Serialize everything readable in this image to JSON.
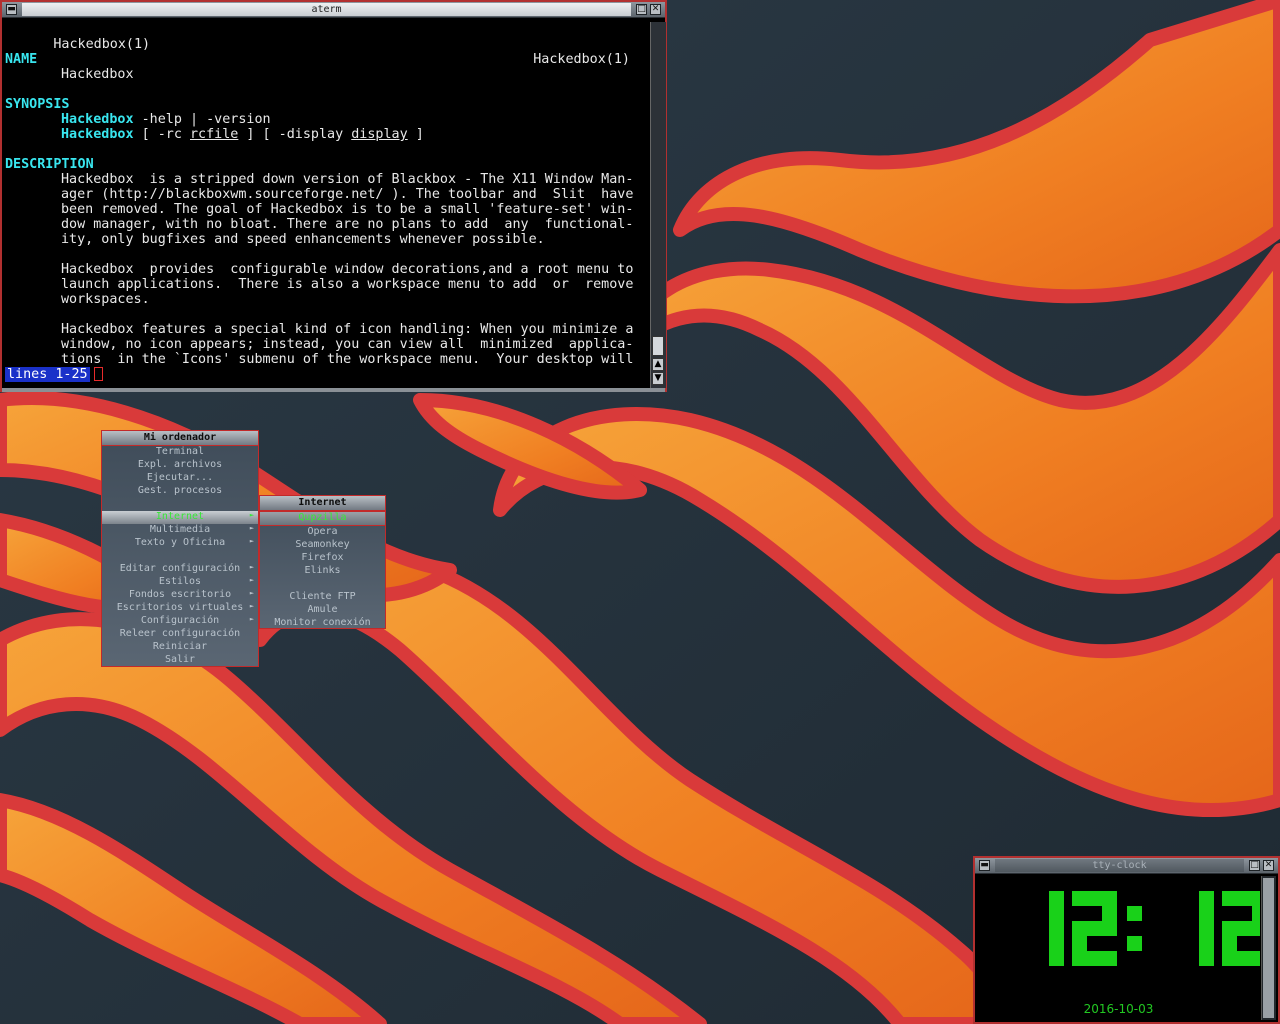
{
  "aterm": {
    "title": "aterm",
    "header_left": "Hackedbox(1)",
    "header_right": "Hackedbox(1)",
    "name_heading": "NAME",
    "name_text": "Hackedbox",
    "synopsis_heading": "SYNOPSIS",
    "syn1_cmd": "Hackedbox",
    "syn1_rest": " -help | -version",
    "syn2_cmd": "Hackedbox",
    "syn2_a": " [ -rc ",
    "syn2_b": "rcfile",
    "syn2_c": " ] [ -display ",
    "syn2_d": "display",
    "syn2_e": " ]",
    "description_heading": "DESCRIPTION",
    "description_lines": [
      "Hackedbox  is a stripped down version of Blackbox - The X11 Window Man-",
      "ager (http://blackboxwm.sourceforge.net/ ). The toolbar and  Slit  have",
      "been removed. The goal of Hackedbox is to be a small 'feature-set' win-",
      "dow manager, with no bloat. There are no plans to add  any  functional-",
      "ity, only bugfixes and speed enhancements whenever possible.",
      "",
      "Hackedbox  provides  configurable window decorations,and a root menu to",
      "launch applications.  There is also a workspace menu to add  or  remove",
      "workspaces.",
      "",
      "Hackedbox features a special kind of icon handling: When you minimize a",
      "window, no icon appears; instead, you can view all  minimized  applica-",
      "tions  in the `Icons' submenu of the workspace menu.  Your desktop will"
    ],
    "status": "lines 1-25"
  },
  "root_menu": {
    "title": "Mi ordenador",
    "items": [
      {
        "label": "Terminal",
        "submenu": false
      },
      {
        "label": "Expl. archivos",
        "submenu": false
      },
      {
        "label": "Ejecutar...",
        "submenu": false
      },
      {
        "label": "Gest. procesos",
        "submenu": false
      },
      {
        "label": "",
        "submenu": false
      },
      {
        "label": "Internet",
        "submenu": true,
        "active": true
      },
      {
        "label": "Multimedia",
        "submenu": true
      },
      {
        "label": "Texto y Oficina",
        "submenu": true
      },
      {
        "label": "",
        "submenu": false
      },
      {
        "label": "Editar configuración",
        "submenu": true
      },
      {
        "label": "Estilos",
        "submenu": true
      },
      {
        "label": "Fondos escritorio",
        "submenu": true
      },
      {
        "label": "Escritorios virtuales",
        "submenu": true
      },
      {
        "label": "Configuración",
        "submenu": true
      },
      {
        "label": "Releer configuración",
        "submenu": false
      },
      {
        "label": "Reiniciar",
        "submenu": false
      },
      {
        "label": "Salir",
        "submenu": false
      }
    ]
  },
  "internet_menu": {
    "title": "Internet",
    "items": [
      {
        "label": "Qupzilla",
        "highlighted": true
      },
      {
        "label": "Opera"
      },
      {
        "label": "Seamonkey"
      },
      {
        "label": "Firefox"
      },
      {
        "label": "Elinks"
      },
      {
        "label": ""
      },
      {
        "label": "Cliente FTP"
      },
      {
        "label": "Amule"
      },
      {
        "label": "Monitor conexión"
      }
    ]
  },
  "clock": {
    "title": "tty-clock",
    "time": "12:12",
    "date": "2016-10-03"
  },
  "colors": {
    "flame_orange": "#f2882a",
    "flame_red": "#d93a3a",
    "background": "#25323d",
    "clock_green": "#19d119",
    "man_cyan": "#39e6ef"
  }
}
